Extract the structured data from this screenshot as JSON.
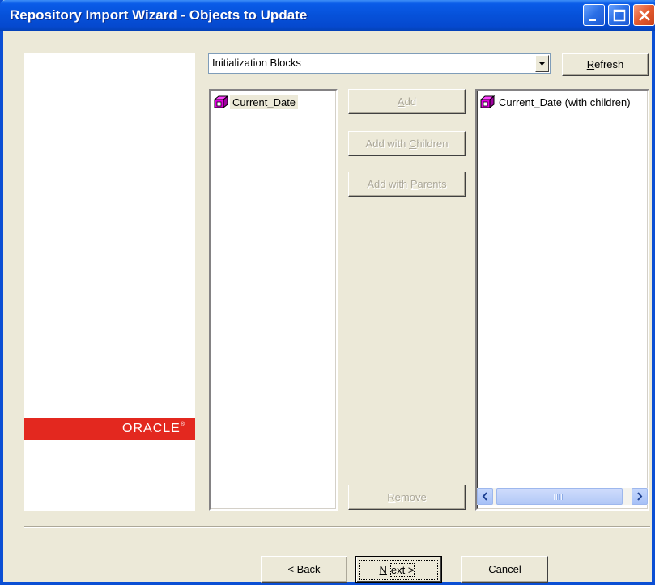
{
  "window": {
    "title": "Repository Import Wizard - Objects to Update"
  },
  "brand": {
    "logo_text": "ORACLE",
    "logo_color": "#e3281f"
  },
  "type_selector": {
    "selected": "Initialization Blocks"
  },
  "buttons": {
    "refresh_prefix": "R",
    "refresh_rest": "efresh",
    "add_prefix": "A",
    "add_rest": "dd",
    "add_children_pre": "Add with ",
    "add_children_u": "C",
    "add_children_post": "hildren",
    "add_parents_pre": "Add with ",
    "add_parents_u": "P",
    "add_parents_post": "arents",
    "remove_prefix": "R",
    "remove_rest": "emove",
    "back_pre": "< ",
    "back_u": "B",
    "back_post": "ack",
    "next_u": "N",
    "next_post": "ext >",
    "cancel": "Cancel"
  },
  "source_list": {
    "items": [
      {
        "label": "Current_Date",
        "icon": "initialization-block-icon",
        "selected": true
      }
    ]
  },
  "target_list": {
    "items": [
      {
        "label": "Current_Date (with children)",
        "icon": "initialization-block-icon"
      }
    ]
  },
  "colors": {
    "titlebar": "#0651d9",
    "dialog_bg": "#ece9d8",
    "icon_magenta": "#e000e0"
  }
}
